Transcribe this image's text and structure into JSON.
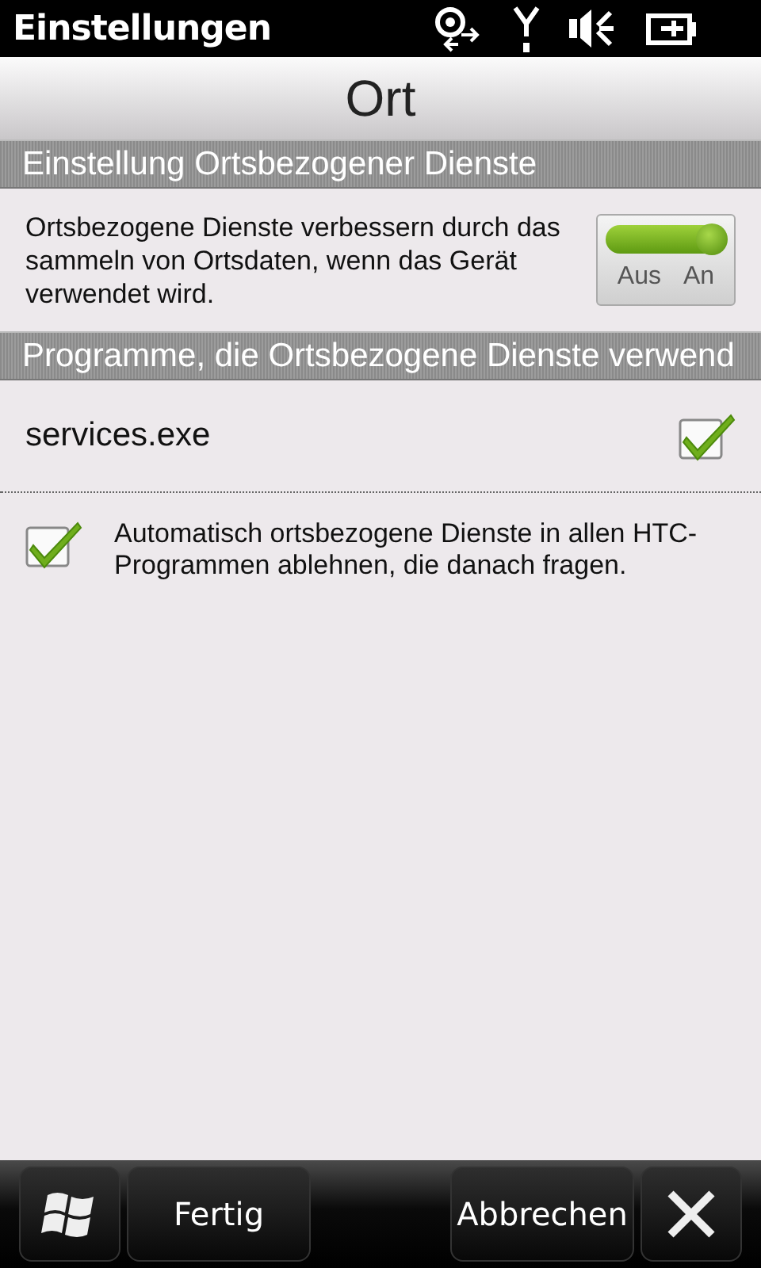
{
  "status_bar": {
    "title": "Einstellungen"
  },
  "header": {
    "title": "Ort"
  },
  "sections": [
    {
      "title": "Einstellung Ortsbezogener Dienste",
      "rows": [
        {
          "kind": "toggle",
          "text": "Ortsbezogene Dienste verbessern durch das sammeln von Ortsdaten, wenn das Gerät verwendet wird.",
          "on": true,
          "off_label": "Aus",
          "on_label": "An"
        }
      ]
    },
    {
      "title": "Programme, die Ortsbezogene Dienste verwend",
      "rows": [
        {
          "kind": "app",
          "text": "services.exe",
          "checked": true
        },
        {
          "kind": "checkbox",
          "text": "Automatisch ortsbezogene Dienste in allen HTC-Programmen ablehnen, die danach fragen.",
          "checked": true
        }
      ]
    }
  ],
  "buttons": [
    {
      "label": "Fertig"
    },
    {
      "label": "Abbrechen"
    }
  ]
}
